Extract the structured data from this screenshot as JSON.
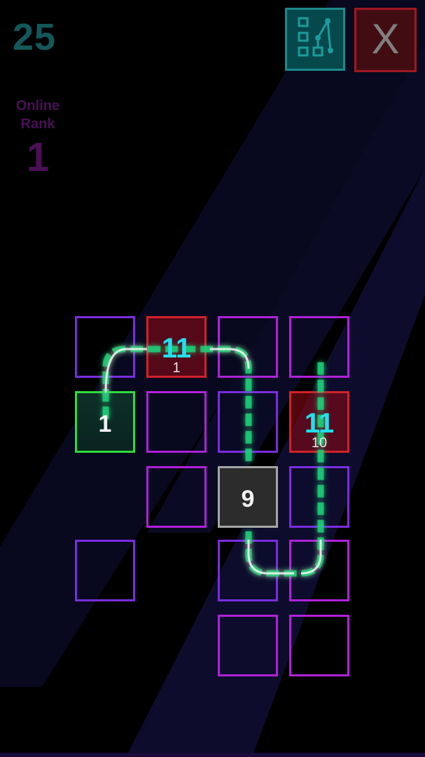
{
  "hud": {
    "score": "25",
    "rank_label": "Online\nRank",
    "rank_value": "1",
    "map_button_icon": "level-map-icon",
    "close_button_label": "X"
  },
  "board": {
    "colors": {
      "purple": "#8c24d6",
      "magenta": "#b021d9",
      "red": "#d1222a",
      "green": "#2edb3c",
      "gray": "#a6a6a6",
      "path": "#1fcf78",
      "cyan_number": "#22e0ee"
    },
    "tiles": [
      {
        "name": "tile-r0-c0",
        "row": 0,
        "col": 0,
        "style": "violet"
      },
      {
        "name": "tile-r0-c1",
        "row": 0,
        "col": 1,
        "style": "red",
        "value": "11",
        "sub": "1"
      },
      {
        "name": "tile-r0-c2",
        "row": 0,
        "col": 2,
        "style": "magenta"
      },
      {
        "name": "tile-r0-c3",
        "row": 0,
        "col": 3,
        "style": "magenta"
      },
      {
        "name": "tile-r1-c0",
        "row": 1,
        "col": 0,
        "style": "green",
        "value": "1"
      },
      {
        "name": "tile-r1-c1",
        "row": 1,
        "col": 1,
        "style": "magenta"
      },
      {
        "name": "tile-r1-c2",
        "row": 1,
        "col": 2,
        "style": "violet"
      },
      {
        "name": "tile-r1-c3",
        "row": 1,
        "col": 3,
        "style": "red",
        "value": "11",
        "sub": "10"
      },
      {
        "name": "tile-r2-c1",
        "row": 2,
        "col": 1,
        "style": "magenta"
      },
      {
        "name": "tile-r2-c2",
        "row": 2,
        "col": 2,
        "style": "gray",
        "value": "9"
      },
      {
        "name": "tile-r2-c3",
        "row": 2,
        "col": 3,
        "style": "violet"
      },
      {
        "name": "tile-r3-c0",
        "row": 3,
        "col": 0,
        "style": "violet"
      },
      {
        "name": "tile-r3-c2",
        "row": 3,
        "col": 2,
        "style": "violet"
      },
      {
        "name": "tile-r3-c3",
        "row": 3,
        "col": 3,
        "style": "magenta"
      },
      {
        "name": "tile-r4-c2",
        "row": 4,
        "col": 2,
        "style": "magenta"
      },
      {
        "name": "tile-r4-c3",
        "row": 4,
        "col": 3,
        "style": "magenta"
      }
    ]
  }
}
